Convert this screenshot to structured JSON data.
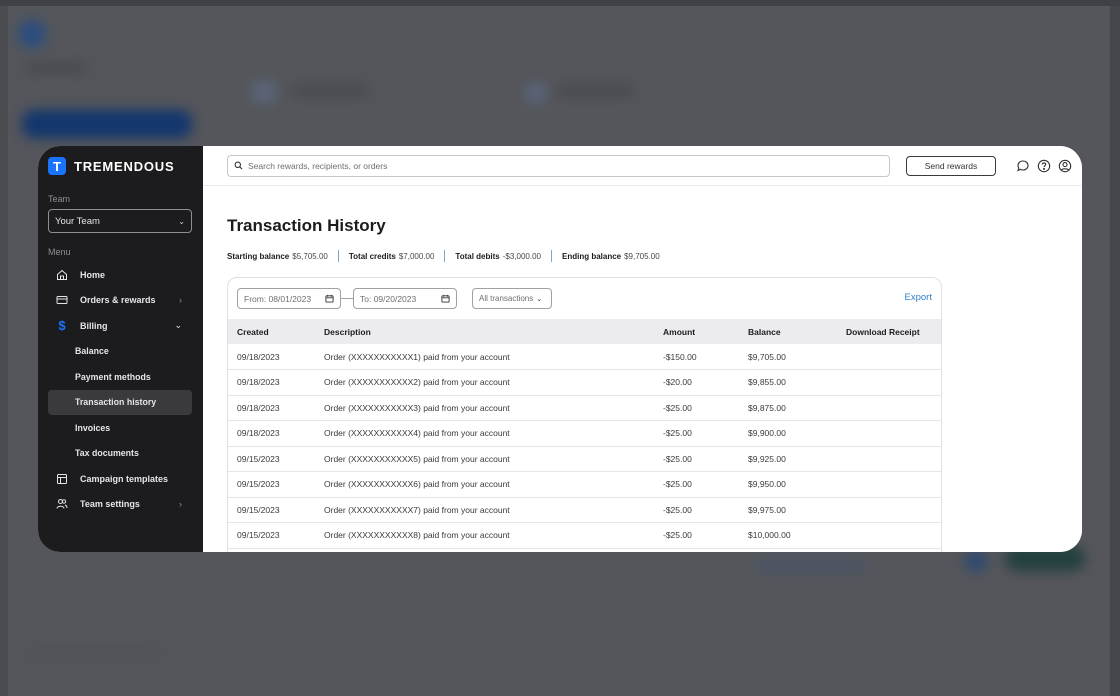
{
  "brand": {
    "name": "TREMENDOUS",
    "logo_letter": "T",
    "color": "#1a73ff"
  },
  "sidebar": {
    "team_label": "Team",
    "team_value": "Your Team",
    "menu_label": "Menu",
    "items": [
      {
        "label": "Home",
        "icon": "home-icon",
        "arrow": ""
      },
      {
        "label": "Orders & rewards",
        "icon": "card-icon",
        "arrow": ">"
      },
      {
        "label": "Billing",
        "icon": "dollar-icon",
        "arrow": "v"
      }
    ],
    "billing_sub": [
      {
        "label": "Balance",
        "active": false
      },
      {
        "label": "Payment methods",
        "active": false
      },
      {
        "label": "Transaction history",
        "active": true
      },
      {
        "label": "Invoices",
        "active": false
      },
      {
        "label": "Tax documents",
        "active": false
      }
    ],
    "items_after": [
      {
        "label": "Campaign templates",
        "icon": "template-icon",
        "arrow": ""
      },
      {
        "label": "Team settings",
        "icon": "users-icon",
        "arrow": ">"
      }
    ]
  },
  "topbar": {
    "search_placeholder": "Search rewards, recipients, or orders",
    "send_rewards": "Send rewards",
    "icons": [
      "chat-icon",
      "help-icon",
      "account-icon"
    ]
  },
  "page": {
    "title": "Transaction History",
    "summary": [
      {
        "label": "Starting balance",
        "value": "$5,705.00"
      },
      {
        "label": "Total credits",
        "value": "$7,000.00"
      },
      {
        "label": "Total debits",
        "value": "-$3,000.00"
      },
      {
        "label": "Ending balance",
        "value": "$9,705.00"
      }
    ]
  },
  "filters": {
    "from": "From: 08/01/2023",
    "to": "To: 09/20/2023",
    "type": "All transactions",
    "export": "Export"
  },
  "table": {
    "headers": [
      "Created",
      "Description",
      "Amount",
      "Balance",
      "Download Receipt"
    ],
    "rows": [
      [
        "09/18/2023",
        "Order (XXXXXXXXXXX1) paid from your account",
        "-$150.00",
        "$9,705.00",
        ""
      ],
      [
        "09/18/2023",
        "Order (XXXXXXXXXXX2) paid from your account",
        "-$20.00",
        "$9,855.00",
        ""
      ],
      [
        "09/18/2023",
        "Order (XXXXXXXXXXX3) paid from your account",
        "-$25.00",
        "$9,875.00",
        ""
      ],
      [
        "09/18/2023",
        "Order (XXXXXXXXXXX4) paid from your account",
        "-$25.00",
        "$9,900.00",
        ""
      ],
      [
        "09/15/2023",
        "Order (XXXXXXXXXXX5) paid from your account",
        "-$25.00",
        "$9,925.00",
        ""
      ],
      [
        "09/15/2023",
        "Order (XXXXXXXXXXX6) paid from your account",
        "-$25.00",
        "$9,950.00",
        ""
      ],
      [
        "09/15/2023",
        "Order (XXXXXXXXXXX7) paid from your account",
        "-$25.00",
        "$9,975.00",
        ""
      ],
      [
        "09/15/2023",
        "Order (XXXXXXXXXXX8) paid from your account",
        "-$25.00",
        "$10,000.00",
        ""
      ]
    ]
  }
}
